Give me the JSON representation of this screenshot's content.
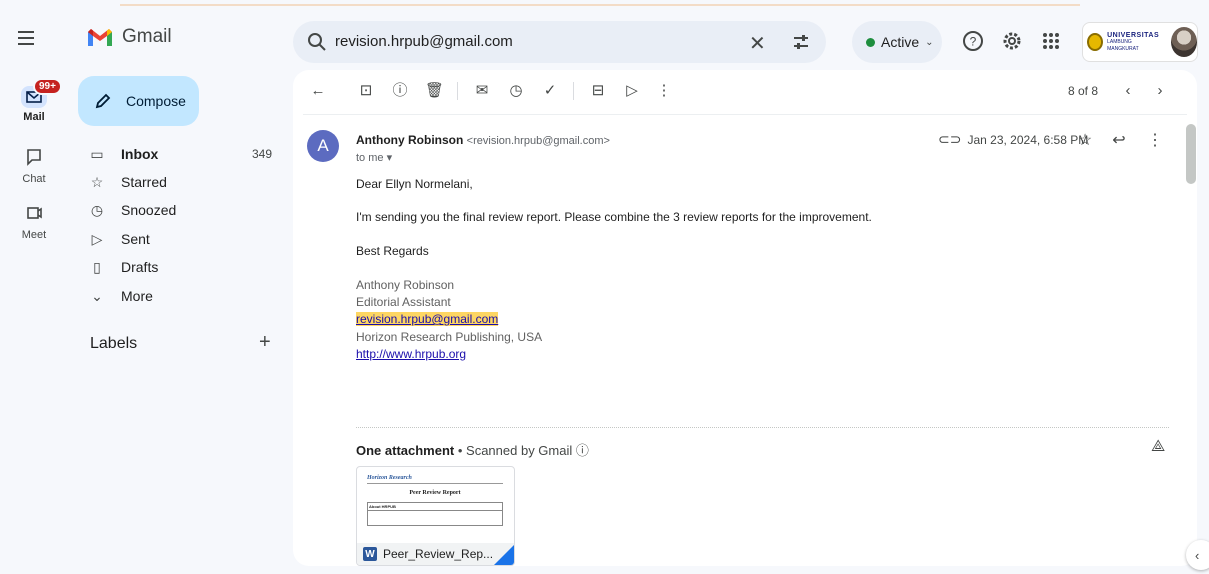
{
  "app": {
    "name": "Gmail"
  },
  "search": {
    "value": "revision.hrpub@gmail.com",
    "clear": "✕"
  },
  "status": {
    "label": "Active"
  },
  "university": {
    "line1": "UNIVERSITAS",
    "line2": "LAMBUNG MANGKURAT"
  },
  "rail": {
    "mail_label": "Mail",
    "mail_badge": "99+",
    "chat_label": "Chat",
    "meet_label": "Meet"
  },
  "sidebar": {
    "compose_label": "Compose",
    "items": [
      {
        "label": "Inbox",
        "count": "349",
        "icon": "inbox-icon"
      },
      {
        "label": "Starred",
        "count": "",
        "icon": "star-icon"
      },
      {
        "label": "Snoozed",
        "count": "",
        "icon": "clock-icon"
      },
      {
        "label": "Sent",
        "count": "",
        "icon": "send-icon"
      },
      {
        "label": "Drafts",
        "count": "",
        "icon": "draft-icon"
      },
      {
        "label": "More",
        "count": "",
        "icon": "chevron-down-icon"
      }
    ],
    "labels_title": "Labels",
    "labels_add": "+"
  },
  "toolbar": {
    "pager": "8 of 8"
  },
  "message": {
    "avatar_letter": "A",
    "from_name": "Anthony Robinson",
    "from_email": "<revision.hrpub@gmail.com>",
    "to": "to me ▾",
    "date": "Jan 23, 2024, 6:58 PM",
    "greeting": "Dear Ellyn Normelani,",
    "body": "I'm sending you the final review report. Please combine the 3 review reports for the improvement.",
    "closing": "Best Regards",
    "signature": {
      "name": "Anthony Robinson",
      "title": "Editorial Assistant",
      "email": "revision.hrpub@gmail.com",
      "org": "Horizon Research Publishing, USA",
      "url": "http://www.hrpub.org"
    }
  },
  "attachments": {
    "title": "One attachment",
    "scan_note": " • Scanned by Gmail ⓘ",
    "file_name": "Peer_Review_Rep...",
    "file_type": "W",
    "preview": {
      "logo": "Horizon Research",
      "doc_title": "Peer Review Report",
      "section": "About HRPUB"
    }
  },
  "colors": {
    "compose_bg": "#c2e7ff",
    "active_dot": "#1e8e3e",
    "badge": "#c5221f",
    "link": "#1a0dab",
    "highlight": "#fdd663",
    "avatar_bg": "#5c6bc0"
  }
}
